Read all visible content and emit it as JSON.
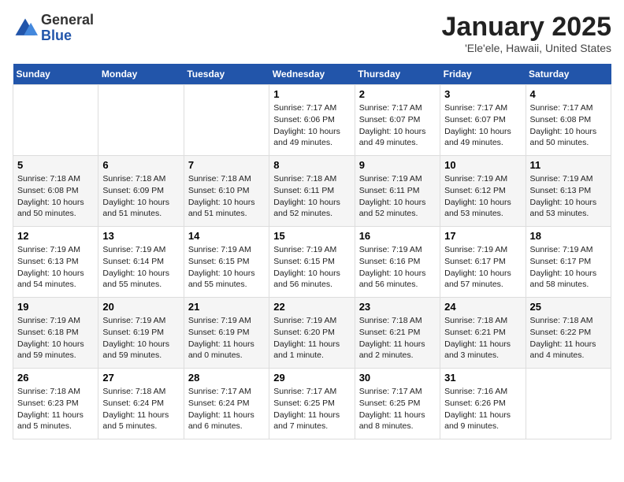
{
  "logo": {
    "general": "General",
    "blue": "Blue"
  },
  "header": {
    "title": "January 2025",
    "subtitle": "'Ele'ele, Hawaii, United States"
  },
  "weekdays": [
    "Sunday",
    "Monday",
    "Tuesday",
    "Wednesday",
    "Thursday",
    "Friday",
    "Saturday"
  ],
  "weeks": [
    [
      {
        "day": null,
        "sunrise": null,
        "sunset": null,
        "daylight": null
      },
      {
        "day": null,
        "sunrise": null,
        "sunset": null,
        "daylight": null
      },
      {
        "day": null,
        "sunrise": null,
        "sunset": null,
        "daylight": null
      },
      {
        "day": "1",
        "sunrise": "Sunrise: 7:17 AM",
        "sunset": "Sunset: 6:06 PM",
        "daylight": "Daylight: 10 hours and 49 minutes."
      },
      {
        "day": "2",
        "sunrise": "Sunrise: 7:17 AM",
        "sunset": "Sunset: 6:07 PM",
        "daylight": "Daylight: 10 hours and 49 minutes."
      },
      {
        "day": "3",
        "sunrise": "Sunrise: 7:17 AM",
        "sunset": "Sunset: 6:07 PM",
        "daylight": "Daylight: 10 hours and 49 minutes."
      },
      {
        "day": "4",
        "sunrise": "Sunrise: 7:17 AM",
        "sunset": "Sunset: 6:08 PM",
        "daylight": "Daylight: 10 hours and 50 minutes."
      }
    ],
    [
      {
        "day": "5",
        "sunrise": "Sunrise: 7:18 AM",
        "sunset": "Sunset: 6:08 PM",
        "daylight": "Daylight: 10 hours and 50 minutes."
      },
      {
        "day": "6",
        "sunrise": "Sunrise: 7:18 AM",
        "sunset": "Sunset: 6:09 PM",
        "daylight": "Daylight: 10 hours and 51 minutes."
      },
      {
        "day": "7",
        "sunrise": "Sunrise: 7:18 AM",
        "sunset": "Sunset: 6:10 PM",
        "daylight": "Daylight: 10 hours and 51 minutes."
      },
      {
        "day": "8",
        "sunrise": "Sunrise: 7:18 AM",
        "sunset": "Sunset: 6:11 PM",
        "daylight": "Daylight: 10 hours and 52 minutes."
      },
      {
        "day": "9",
        "sunrise": "Sunrise: 7:19 AM",
        "sunset": "Sunset: 6:11 PM",
        "daylight": "Daylight: 10 hours and 52 minutes."
      },
      {
        "day": "10",
        "sunrise": "Sunrise: 7:19 AM",
        "sunset": "Sunset: 6:12 PM",
        "daylight": "Daylight: 10 hours and 53 minutes."
      },
      {
        "day": "11",
        "sunrise": "Sunrise: 7:19 AM",
        "sunset": "Sunset: 6:13 PM",
        "daylight": "Daylight: 10 hours and 53 minutes."
      }
    ],
    [
      {
        "day": "12",
        "sunrise": "Sunrise: 7:19 AM",
        "sunset": "Sunset: 6:13 PM",
        "daylight": "Daylight: 10 hours and 54 minutes."
      },
      {
        "day": "13",
        "sunrise": "Sunrise: 7:19 AM",
        "sunset": "Sunset: 6:14 PM",
        "daylight": "Daylight: 10 hours and 55 minutes."
      },
      {
        "day": "14",
        "sunrise": "Sunrise: 7:19 AM",
        "sunset": "Sunset: 6:15 PM",
        "daylight": "Daylight: 10 hours and 55 minutes."
      },
      {
        "day": "15",
        "sunrise": "Sunrise: 7:19 AM",
        "sunset": "Sunset: 6:15 PM",
        "daylight": "Daylight: 10 hours and 56 minutes."
      },
      {
        "day": "16",
        "sunrise": "Sunrise: 7:19 AM",
        "sunset": "Sunset: 6:16 PM",
        "daylight": "Daylight: 10 hours and 56 minutes."
      },
      {
        "day": "17",
        "sunrise": "Sunrise: 7:19 AM",
        "sunset": "Sunset: 6:17 PM",
        "daylight": "Daylight: 10 hours and 57 minutes."
      },
      {
        "day": "18",
        "sunrise": "Sunrise: 7:19 AM",
        "sunset": "Sunset: 6:17 PM",
        "daylight": "Daylight: 10 hours and 58 minutes."
      }
    ],
    [
      {
        "day": "19",
        "sunrise": "Sunrise: 7:19 AM",
        "sunset": "Sunset: 6:18 PM",
        "daylight": "Daylight: 10 hours and 59 minutes."
      },
      {
        "day": "20",
        "sunrise": "Sunrise: 7:19 AM",
        "sunset": "Sunset: 6:19 PM",
        "daylight": "Daylight: 10 hours and 59 minutes."
      },
      {
        "day": "21",
        "sunrise": "Sunrise: 7:19 AM",
        "sunset": "Sunset: 6:19 PM",
        "daylight": "Daylight: 11 hours and 0 minutes."
      },
      {
        "day": "22",
        "sunrise": "Sunrise: 7:19 AM",
        "sunset": "Sunset: 6:20 PM",
        "daylight": "Daylight: 11 hours and 1 minute."
      },
      {
        "day": "23",
        "sunrise": "Sunrise: 7:18 AM",
        "sunset": "Sunset: 6:21 PM",
        "daylight": "Daylight: 11 hours and 2 minutes."
      },
      {
        "day": "24",
        "sunrise": "Sunrise: 7:18 AM",
        "sunset": "Sunset: 6:21 PM",
        "daylight": "Daylight: 11 hours and 3 minutes."
      },
      {
        "day": "25",
        "sunrise": "Sunrise: 7:18 AM",
        "sunset": "Sunset: 6:22 PM",
        "daylight": "Daylight: 11 hours and 4 minutes."
      }
    ],
    [
      {
        "day": "26",
        "sunrise": "Sunrise: 7:18 AM",
        "sunset": "Sunset: 6:23 PM",
        "daylight": "Daylight: 11 hours and 5 minutes."
      },
      {
        "day": "27",
        "sunrise": "Sunrise: 7:18 AM",
        "sunset": "Sunset: 6:24 PM",
        "daylight": "Daylight: 11 hours and 5 minutes."
      },
      {
        "day": "28",
        "sunrise": "Sunrise: 7:17 AM",
        "sunset": "Sunset: 6:24 PM",
        "daylight": "Daylight: 11 hours and 6 minutes."
      },
      {
        "day": "29",
        "sunrise": "Sunrise: 7:17 AM",
        "sunset": "Sunset: 6:25 PM",
        "daylight": "Daylight: 11 hours and 7 minutes."
      },
      {
        "day": "30",
        "sunrise": "Sunrise: 7:17 AM",
        "sunset": "Sunset: 6:25 PM",
        "daylight": "Daylight: 11 hours and 8 minutes."
      },
      {
        "day": "31",
        "sunrise": "Sunrise: 7:16 AM",
        "sunset": "Sunset: 6:26 PM",
        "daylight": "Daylight: 11 hours and 9 minutes."
      },
      {
        "day": null,
        "sunrise": null,
        "sunset": null,
        "daylight": null
      }
    ]
  ]
}
